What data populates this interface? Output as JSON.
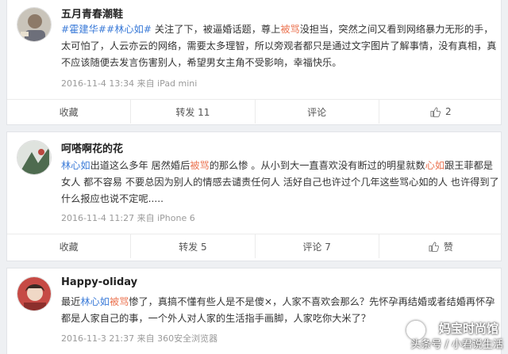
{
  "posts": [
    {
      "username": "五月青春潮鞋",
      "text": [
        {
          "t": "#霍建华#",
          "c": "lk"
        },
        {
          "t": "#林心如#",
          "c": "lk"
        },
        {
          "t": " 关注了下，被逼婚话题，尊上",
          "c": ""
        },
        {
          "t": "被骂",
          "c": "kw"
        },
        {
          "t": "没担当，突然之间又看到网络暴力无形的手，太可怕了，人云亦云的网络，需要太多理智，所以旁观者都只是通过文字图片了解事情，没有真相，真不应该随便去发言伤害别人，希望男女主角不受影响，幸福快乐。",
          "c": ""
        }
      ],
      "meta": "2016-11-4 13:34 来自 iPad mini",
      "actions": {
        "favorite": "收藏",
        "repost": "转发 11",
        "comment": "评论",
        "like": "2"
      }
    },
    {
      "username": "呵嗒啊花的花",
      "text": [
        {
          "t": "林心如",
          "c": "lk"
        },
        {
          "t": "出道这么多年 居然婚后",
          "c": ""
        },
        {
          "t": "被骂",
          "c": "kw"
        },
        {
          "t": "的那么惨 。从小到大一直喜欢没有断过的明星就数",
          "c": ""
        },
        {
          "t": "心如",
          "c": "kw"
        },
        {
          "t": "跟王菲都是女人 都不容易 不要总因为别人的情感去谴责任何人 活好自己也许过个几年这些骂心如的人 也许得到了什么报应也说不定呢.....",
          "c": ""
        }
      ],
      "meta": "2016-11-4 11:27 来自 iPhone 6",
      "actions": {
        "favorite": "收藏",
        "repost": "转发 5",
        "comment": "评论 7",
        "like": "赞"
      }
    },
    {
      "username": "Happy-oliday",
      "text": [
        {
          "t": "最近",
          "c": ""
        },
        {
          "t": "林心如",
          "c": "lk"
        },
        {
          "t": "被骂",
          "c": "kw"
        },
        {
          "t": "惨了，真搞不懂有些人是不是傻×，人家不喜欢会那么？先怀孕再结婚或者结婚再怀孕都是人家自己的事，一个外人对人家的生活指手画脚，人家吃你大米了？",
          "c": ""
        }
      ],
      "meta": "2016-11-3 21:37 来自 360安全浏览器"
    }
  ],
  "watermark": {
    "line1": "妈宝时尚馆",
    "line2": "头条号 / 小君说生活"
  },
  "colors": {
    "keyword": "#eb7350",
    "link": "#3b7bd8",
    "meta": "#9a9a9a"
  }
}
